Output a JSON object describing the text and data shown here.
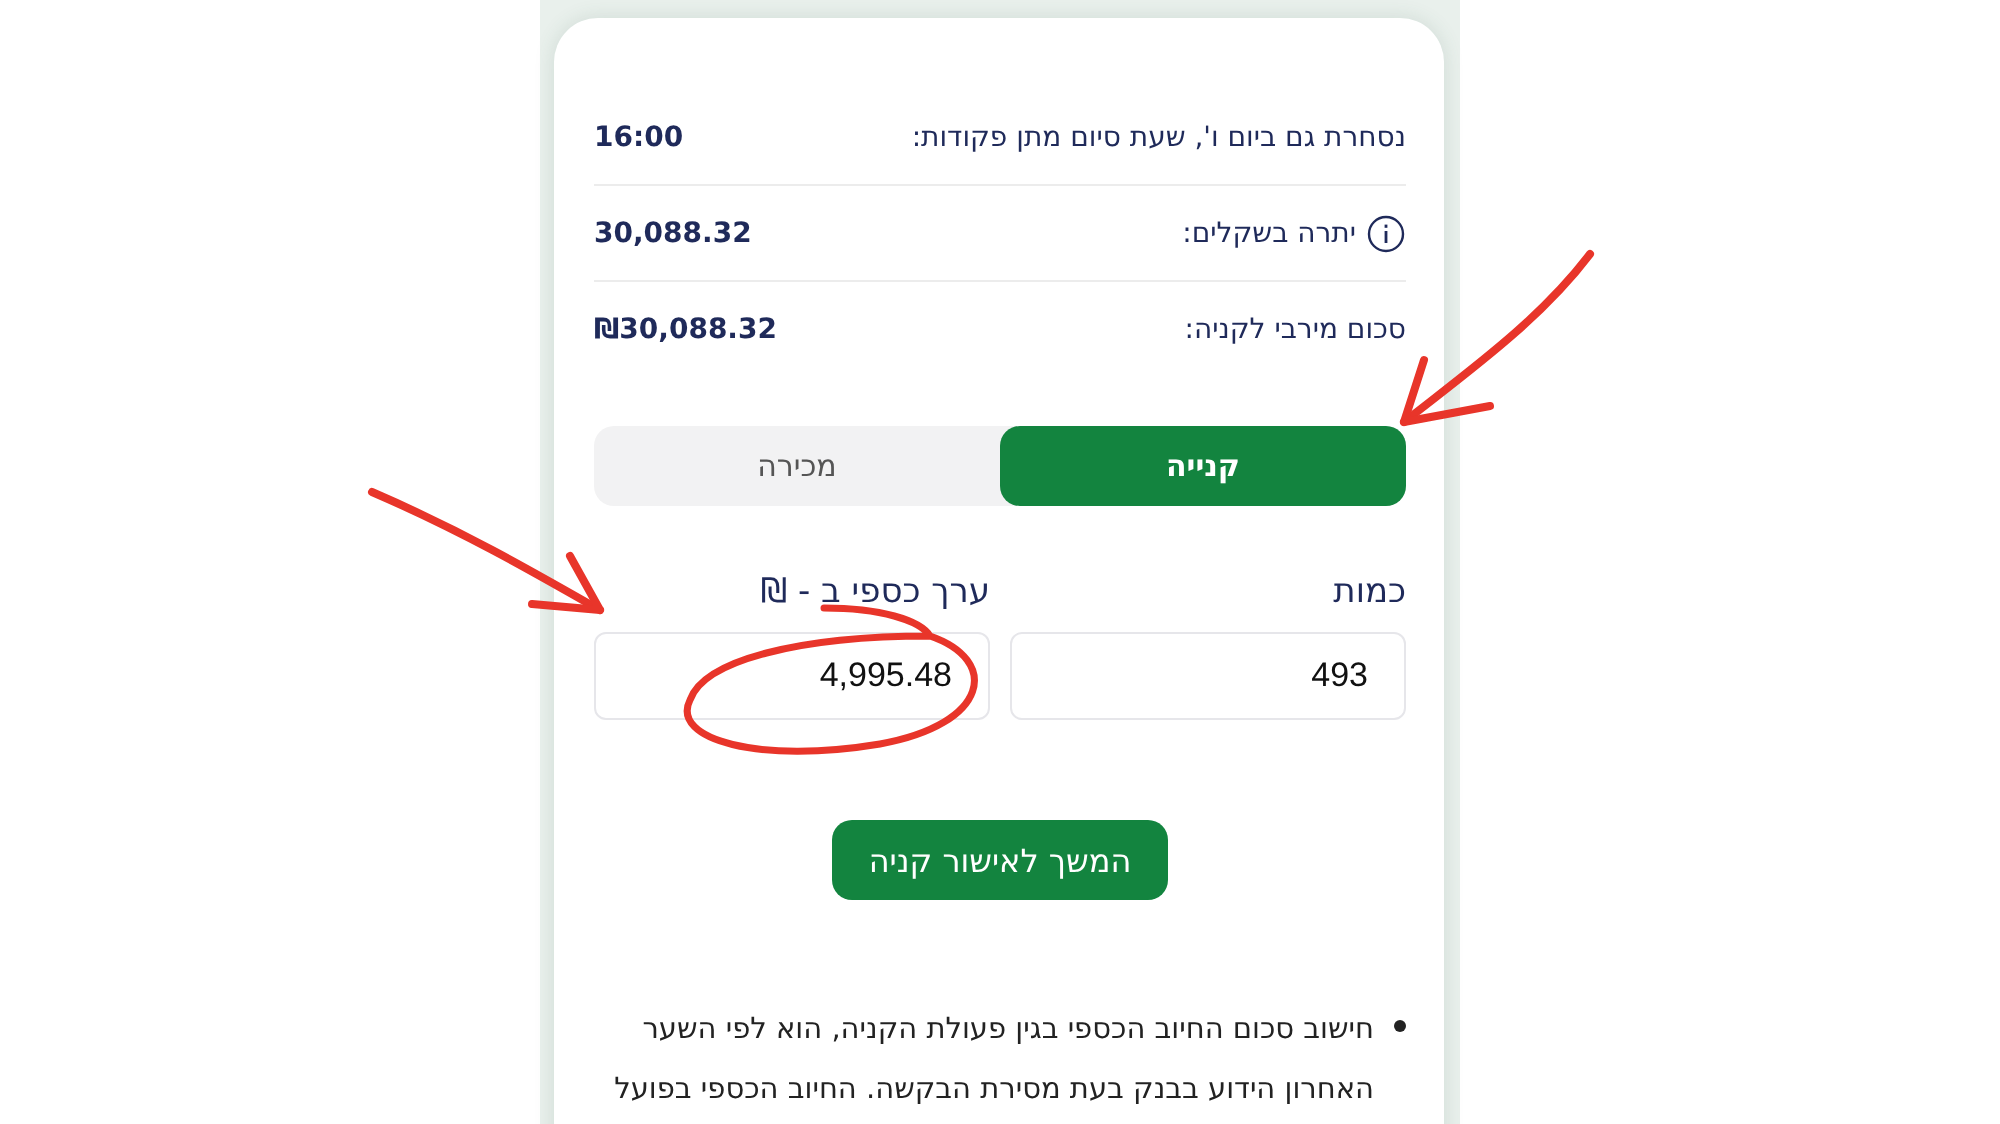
{
  "summary": [
    {
      "label": "נסחרת גם ביום ו', שעת סיום מתן פקודות:",
      "value": "16:00",
      "info": false
    },
    {
      "label": "יתרה בשקלים:",
      "value": "30,088.32",
      "info": true
    },
    {
      "label": "סכום מירבי לקניה:",
      "value": "₪30,088.32",
      "info": false
    }
  ],
  "tabs": [
    {
      "label": "קנייה",
      "selected": true
    },
    {
      "label": "מכירה",
      "selected": false
    }
  ],
  "fields": [
    {
      "label": "כמות",
      "value": "493"
    },
    {
      "label": "ערך כספי ב - ₪",
      "value": "4,995.48"
    }
  ],
  "continue_button": "המשך לאישור קניה",
  "notes": [
    "חישוב סכום החיוב הכספי בגין פעולת הקניה, הוא לפי השער האחרון הידוע בבנק בעת מסירת הבקשה. החיוב הכספי בפועל"
  ]
}
